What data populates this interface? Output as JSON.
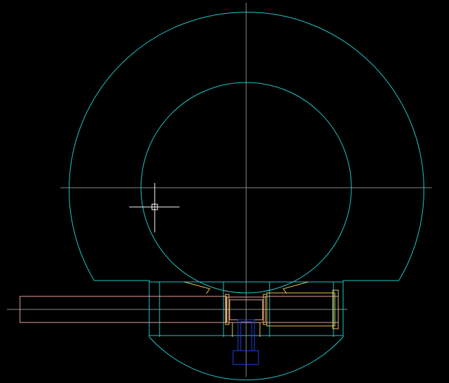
{
  "app": {
    "view": "cad-drawing-viewport"
  },
  "colors": {
    "background": "#000000",
    "outline": "#20c8c8",
    "centerline": "#8a8a8a",
    "pink": "#e8a0a0",
    "yellow": "#e8c850",
    "blue": "#2040e0",
    "crosshair": "#ffffff"
  },
  "icons": {
    "cursor": "crosshair-cursor-icon"
  }
}
